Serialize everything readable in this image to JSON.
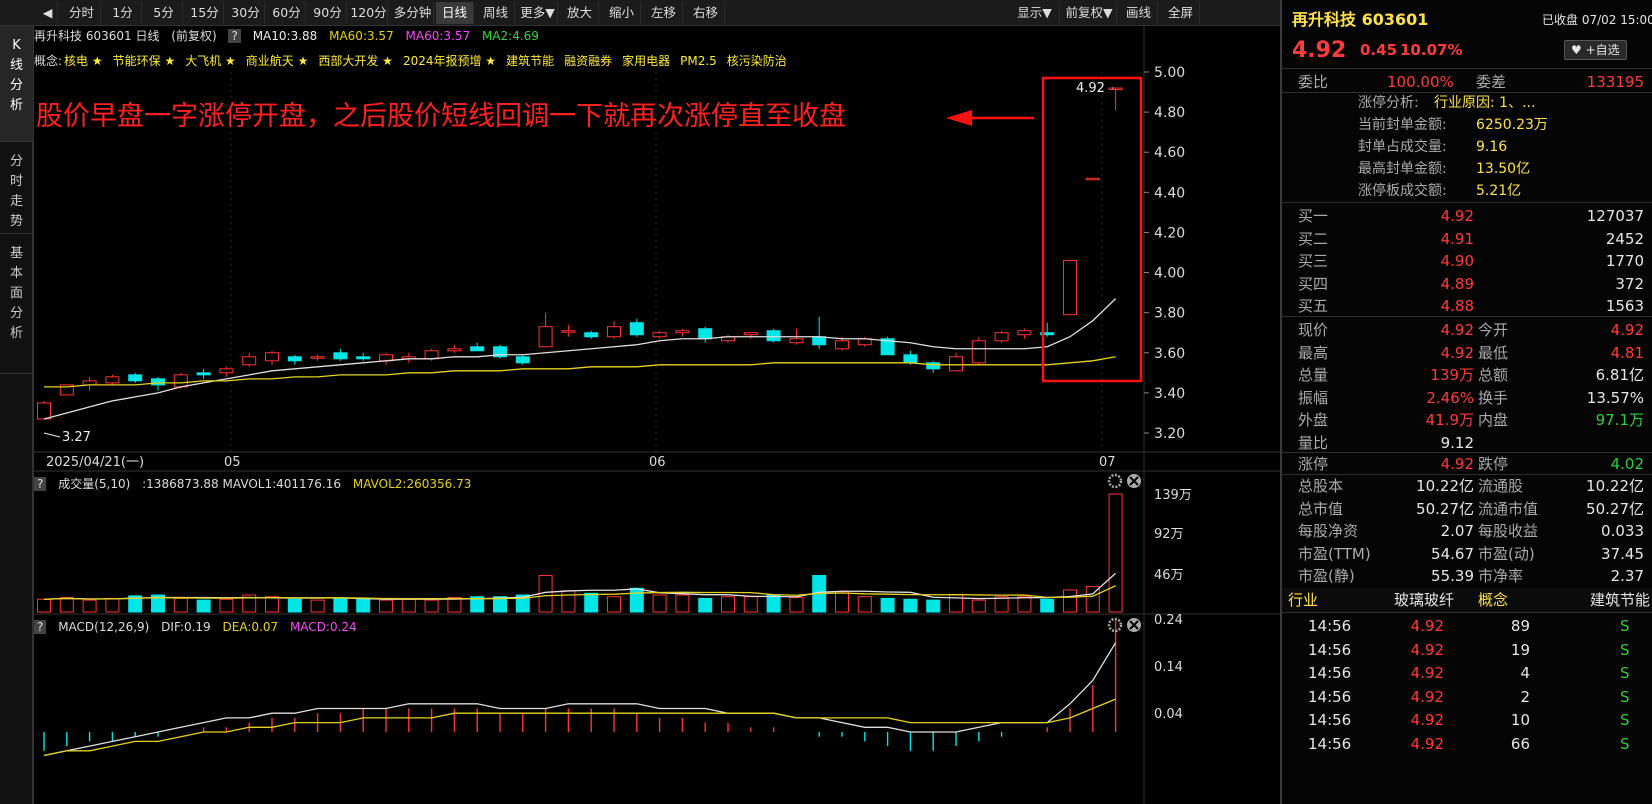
{
  "toolbar": {
    "items": [
      "◀",
      "分时",
      "1分",
      "5分",
      "15分",
      "30分",
      "60分",
      "90分",
      "120分",
      "多分钟",
      "日线",
      "周线",
      "更多▼",
      "放大",
      "缩小",
      "左移",
      "右移",
      "显示▼",
      "前复权▼",
      "画线",
      "全屏"
    ],
    "active": "日线"
  },
  "side_tabs": [
    "K线分析",
    "分时走势",
    "基本面分析"
  ],
  "main_header": {
    "title": "再升科技 603601 日线",
    "adj": "(前复权)",
    "q": "?",
    "ma10": "MA10:3.88",
    "ma60a": "MA60:3.57",
    "ma60b": "MA60:3.57",
    "ma2": "MA2:4.69"
  },
  "concepts_label": "概念:",
  "concepts": [
    "核电 ★",
    "节能环保 ★",
    "大飞机 ★",
    "商业航天 ★",
    "西部大开发 ★",
    "2024年报预增 ★",
    "建筑节能",
    "融资融券",
    "家用电器",
    "PM2.5",
    "核污染防治"
  ],
  "annotation": "股价早盘一字涨停开盘，之后股价短线回调一下就再次涨停直至收盘",
  "labels": {
    "high": "4.92",
    "low": "3.27",
    "date_start": "2025/04/21(一)",
    "m05": "05",
    "m06": "06",
    "m07": "07"
  },
  "volume_header": {
    "q": "?",
    "name": "成交量(5,10)",
    "val": ":1386873.88",
    "mavol1": "MAVOL1:401176.16",
    "mavol2": "MAVOL2:260356.73"
  },
  "macd_header": {
    "q": "?",
    "name": "MACD(12,26,9)",
    "dif": "DIF:0.19",
    "dea": "DEA:0.07",
    "macd": "MACD:0.24"
  },
  "colors": {
    "up": "#ff3333",
    "down": "#00e6e6",
    "ma_white": "#e0e0e0",
    "ma_yellow": "#e6d21e",
    "macd_pink": "#ff44ff"
  },
  "chart_data": {
    "type": "candlestick",
    "price_axis": {
      "ticks": [
        "5.00",
        "4.80",
        "4.60",
        "4.40",
        "4.20",
        "4.00",
        "3.80",
        "3.60",
        "3.40",
        "3.20"
      ],
      "range": [
        3.2,
        5.0
      ]
    },
    "volume_axis": {
      "ticks": [
        "139万",
        "92万",
        "46万"
      ]
    },
    "macd_axis": {
      "ticks": [
        "0.24",
        "0.14",
        "0.04"
      ]
    },
    "candles": [
      [
        3.27,
        3.36,
        3.27,
        3.35
      ],
      [
        3.39,
        3.44,
        3.39,
        3.44
      ],
      [
        3.44,
        3.48,
        3.41,
        3.46
      ],
      [
        3.45,
        3.49,
        3.44,
        3.48
      ],
      [
        3.49,
        3.5,
        3.45,
        3.46
      ],
      [
        3.47,
        3.48,
        3.41,
        3.44
      ],
      [
        3.43,
        3.5,
        3.42,
        3.49
      ],
      [
        3.5,
        3.52,
        3.47,
        3.49
      ],
      [
        3.5,
        3.53,
        3.48,
        3.52
      ],
      [
        3.54,
        3.6,
        3.53,
        3.58
      ],
      [
        3.56,
        3.61,
        3.54,
        3.6
      ],
      [
        3.58,
        3.59,
        3.54,
        3.56
      ],
      [
        3.58,
        3.59,
        3.56,
        3.58
      ],
      [
        3.6,
        3.62,
        3.56,
        3.57
      ],
      [
        3.58,
        3.6,
        3.56,
        3.57
      ],
      [
        3.56,
        3.6,
        3.54,
        3.59
      ],
      [
        3.57,
        3.6,
        3.55,
        3.58
      ],
      [
        3.57,
        3.62,
        3.56,
        3.61
      ],
      [
        3.61,
        3.64,
        3.6,
        3.62
      ],
      [
        3.63,
        3.65,
        3.61,
        3.61
      ],
      [
        3.63,
        3.64,
        3.57,
        3.58
      ],
      [
        3.58,
        3.59,
        3.54,
        3.55
      ],
      [
        3.63,
        3.8,
        3.63,
        3.73
      ],
      [
        3.71,
        3.74,
        3.68,
        3.71
      ],
      [
        3.7,
        3.71,
        3.67,
        3.68
      ],
      [
        3.68,
        3.76,
        3.67,
        3.73
      ],
      [
        3.75,
        3.77,
        3.68,
        3.69
      ],
      [
        3.68,
        3.71,
        3.67,
        3.7
      ],
      [
        3.7,
        3.72,
        3.68,
        3.71
      ],
      [
        3.72,
        3.73,
        3.65,
        3.67
      ],
      [
        3.66,
        3.69,
        3.65,
        3.68
      ],
      [
        3.69,
        3.7,
        3.67,
        3.7
      ],
      [
        3.71,
        3.72,
        3.65,
        3.66
      ],
      [
        3.65,
        3.72,
        3.64,
        3.67
      ],
      [
        3.68,
        3.78,
        3.62,
        3.64
      ],
      [
        3.62,
        3.68,
        3.61,
        3.66
      ],
      [
        3.64,
        3.68,
        3.63,
        3.67
      ],
      [
        3.67,
        3.68,
        3.59,
        3.59
      ],
      [
        3.59,
        3.61,
        3.54,
        3.55
      ],
      [
        3.55,
        3.56,
        3.5,
        3.52
      ],
      [
        3.51,
        3.6,
        3.51,
        3.58
      ],
      [
        3.55,
        3.68,
        3.54,
        3.66
      ],
      [
        3.66,
        3.71,
        3.65,
        3.7
      ],
      [
        3.69,
        3.72,
        3.67,
        3.71
      ],
      [
        3.7,
        3.75,
        3.68,
        3.69
      ],
      [
        3.79,
        4.06,
        3.79,
        4.06
      ],
      [
        4.47,
        4.47,
        4.47,
        4.47
      ],
      [
        4.92,
        4.92,
        4.81,
        4.92
      ]
    ],
    "ma_white": [
      3.27,
      3.3,
      3.33,
      3.36,
      3.38,
      3.4,
      3.43,
      3.45,
      3.47,
      3.49,
      3.51,
      3.52,
      3.53,
      3.54,
      3.55,
      3.56,
      3.57,
      3.57,
      3.58,
      3.58,
      3.59,
      3.59,
      3.6,
      3.61,
      3.62,
      3.63,
      3.64,
      3.66,
      3.67,
      3.67,
      3.68,
      3.68,
      3.68,
      3.68,
      3.68,
      3.67,
      3.67,
      3.66,
      3.65,
      3.63,
      3.62,
      3.62,
      3.62,
      3.62,
      3.63,
      3.68,
      3.76,
      3.87
    ],
    "ma_yellow": [
      3.43,
      3.43,
      3.44,
      3.44,
      3.44,
      3.45,
      3.45,
      3.46,
      3.46,
      3.47,
      3.47,
      3.48,
      3.48,
      3.49,
      3.49,
      3.49,
      3.5,
      3.5,
      3.51,
      3.51,
      3.51,
      3.52,
      3.52,
      3.52,
      3.53,
      3.53,
      3.53,
      3.54,
      3.54,
      3.54,
      3.54,
      3.54,
      3.55,
      3.55,
      3.55,
      3.55,
      3.55,
      3.55,
      3.55,
      3.54,
      3.54,
      3.54,
      3.54,
      3.54,
      3.54,
      3.55,
      3.56,
      3.58
    ],
    "volumes": [
      15,
      17,
      14,
      16,
      19,
      20,
      16,
      14,
      15,
      20,
      18,
      15,
      14,
      16,
      16,
      14,
      15,
      14,
      17,
      18,
      18,
      20,
      43,
      25,
      22,
      18,
      28,
      20,
      20,
      16,
      18,
      18,
      20,
      17,
      43,
      24,
      18,
      16,
      15,
      14,
      20,
      14,
      18,
      18,
      15,
      26,
      30,
      139
    ],
    "macd": [
      -0.04,
      -0.03,
      -0.02,
      -0.02,
      -0.01,
      -0.01,
      0.0,
      0.01,
      0.01,
      0.02,
      0.03,
      0.03,
      0.04,
      0.04,
      0.05,
      0.05,
      0.05,
      0.05,
      0.05,
      0.05,
      0.04,
      0.04,
      0.05,
      0.05,
      0.05,
      0.05,
      0.04,
      0.03,
      0.03,
      0.02,
      0.02,
      0.01,
      0.01,
      0.0,
      -0.01,
      -0.01,
      -0.02,
      -0.03,
      -0.04,
      -0.04,
      -0.03,
      -0.02,
      -0.01,
      0.0,
      0.01,
      0.05,
      0.1,
      0.24
    ],
    "dif": [
      -0.05,
      -0.04,
      -0.03,
      -0.02,
      -0.01,
      0.0,
      0.01,
      0.02,
      0.03,
      0.03,
      0.04,
      0.04,
      0.05,
      0.05,
      0.05,
      0.05,
      0.06,
      0.06,
      0.06,
      0.06,
      0.05,
      0.05,
      0.05,
      0.06,
      0.06,
      0.06,
      0.06,
      0.05,
      0.05,
      0.05,
      0.04,
      0.04,
      0.04,
      0.03,
      0.03,
      0.02,
      0.01,
      0.01,
      0.0,
      0.0,
      0.0,
      0.01,
      0.02,
      0.02,
      0.02,
      0.06,
      0.11,
      0.19
    ],
    "dea": [
      -0.05,
      -0.04,
      -0.04,
      -0.03,
      -0.02,
      -0.02,
      -0.01,
      0.0,
      0.0,
      0.01,
      0.01,
      0.02,
      0.02,
      0.02,
      0.03,
      0.03,
      0.03,
      0.03,
      0.04,
      0.04,
      0.04,
      0.04,
      0.04,
      0.04,
      0.04,
      0.04,
      0.04,
      0.04,
      0.04,
      0.04,
      0.04,
      0.04,
      0.04,
      0.03,
      0.03,
      0.03,
      0.03,
      0.03,
      0.02,
      0.02,
      0.02,
      0.02,
      0.02,
      0.02,
      0.02,
      0.03,
      0.05,
      0.07
    ]
  },
  "right": {
    "title": "再升科技 603601",
    "status": "已收盘 07/02 15:00",
    "price": "4.92",
    "chg": "0.45",
    "pct": "10.07%",
    "fav": "♥ +自选",
    "wb_l": "委比",
    "wb_v": "100.00%",
    "wc_l": "委差",
    "wc_v": "133195",
    "zt_analysis": "涨停分析:",
    "zt_reason": "行业原因: 1、...",
    "seal_items": [
      [
        "当前封单金额:",
        "6250.23万"
      ],
      [
        "封单占成交量:",
        "9.16"
      ],
      [
        "最高封单金额:",
        "13.50亿"
      ],
      [
        "涨停板成交额:",
        "5.21亿"
      ]
    ],
    "bids": [
      [
        "买一",
        "4.92",
        "127037"
      ],
      [
        "买二",
        "4.91",
        "2452"
      ],
      [
        "买三",
        "4.90",
        "1770"
      ],
      [
        "买四",
        "4.89",
        "372"
      ],
      [
        "买五",
        "4.88",
        "1563"
      ]
    ],
    "stats": [
      [
        "现价",
        "4.92",
        "今开",
        "4.92"
      ],
      [
        "最高",
        "4.92",
        "最低",
        "4.81"
      ],
      [
        "总量",
        "139万",
        "总额",
        "6.81亿"
      ],
      [
        "振幅",
        "2.46%",
        "换手",
        "13.57%"
      ],
      [
        "外盘",
        "41.9万",
        "内盘",
        "97.1万"
      ],
      [
        "量比",
        "9.12",
        "",
        ""
      ]
    ],
    "limits": [
      [
        "涨停",
        "4.92",
        "跌停",
        "4.02"
      ]
    ],
    "fund": [
      [
        "总股本",
        "10.22亿",
        "流通股",
        "10.22亿"
      ],
      [
        "总市值",
        "50.27亿",
        "流通市值",
        "50.27亿"
      ],
      [
        "每股净资",
        "2.07",
        "每股收益",
        "0.033"
      ],
      [
        "市盈(TTM)",
        "54.67",
        "市盈(动)",
        "37.45"
      ],
      [
        "市盈(静)",
        "55.39",
        "市净率",
        "2.37"
      ]
    ],
    "industry_l": "行业",
    "industry_v": "玻璃玻纤",
    "concept_l": "概念",
    "concept_v": "建筑节能",
    "trades": [
      [
        "14:56",
        "4.92",
        "89",
        "S"
      ],
      [
        "14:56",
        "4.92",
        "19",
        "S"
      ],
      [
        "14:56",
        "4.92",
        "4",
        "S"
      ],
      [
        "14:56",
        "4.92",
        "2",
        "S"
      ],
      [
        "14:56",
        "4.92",
        "10",
        "S"
      ],
      [
        "14:56",
        "4.92",
        "66",
        "S"
      ]
    ]
  }
}
